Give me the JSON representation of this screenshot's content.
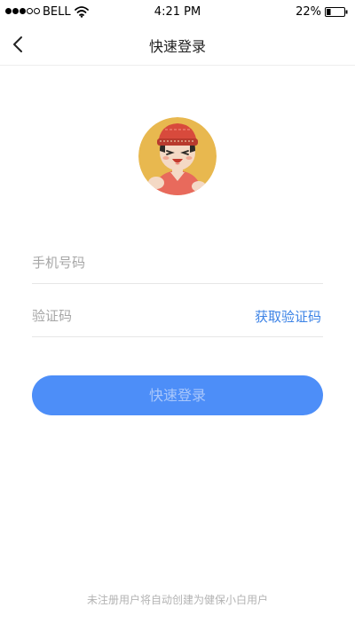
{
  "status_bar": {
    "carrier": "BELL",
    "time": "4:21 PM",
    "battery": "22%",
    "signal_icon": "signal-dots-icon",
    "wifi_icon": "wifi-icon",
    "battery_icon": "battery-icon",
    "signal_level": 3,
    "signal_max": 5,
    "battery_level": 0.22
  },
  "nav": {
    "title": "快速登录",
    "back_icon": "chevron-left-icon"
  },
  "avatar": {
    "icon": "cartoon-avatar-icon",
    "bg_color": "#e8b84f"
  },
  "form": {
    "phone_placeholder": "手机号码",
    "phone_value": "",
    "code_placeholder": "验证码",
    "code_value": "",
    "get_code_label": "获取验证码",
    "submit_label": "快速登录"
  },
  "footer": {
    "note": "未注册用户将自动创建为健保小白用户"
  },
  "colors": {
    "accent": "#3c83e6",
    "button_bg": "#4d8ef8",
    "button_text": "#a9c7fb",
    "placeholder": "#a6a6a6",
    "divider": "#e6e6e6",
    "footer_text": "#b3b3b3"
  }
}
